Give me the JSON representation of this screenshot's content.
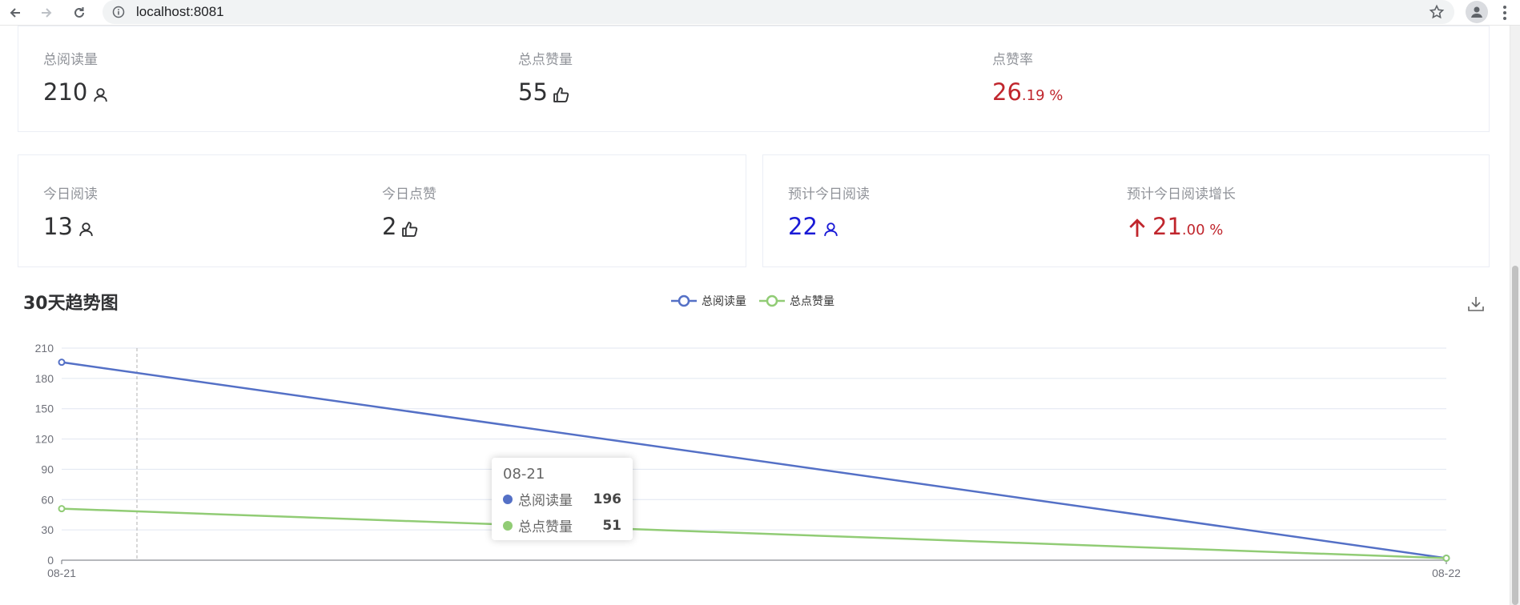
{
  "browser": {
    "url": "localhost:8081"
  },
  "totals": {
    "reads_label": "总阅读量",
    "reads_value": "210",
    "likes_label": "总点赞量",
    "likes_value": "55",
    "rate_label": "点赞率",
    "rate_int": "26",
    "rate_frac": ".19 %"
  },
  "today": {
    "reads_label": "今日阅读",
    "reads_value": "13",
    "likes_label": "今日点赞",
    "likes_value": "2"
  },
  "forecast": {
    "reads_label": "预计今日阅读",
    "reads_value": "22",
    "growth_label": "预计今日阅读增长",
    "growth_int": "21",
    "growth_frac": ".00 %"
  },
  "colors": {
    "accent_red": "#c0262d",
    "accent_blue": "#1a1ad6",
    "series_reads": "#5470c6",
    "series_likes": "#91cc75"
  },
  "icons": {
    "reads": "user-icon",
    "likes": "thumbs-up-icon",
    "growth": "arrow-up-icon",
    "download": "download-icon"
  },
  "chart_data": {
    "type": "line",
    "title": "30天趋势图",
    "categories": [
      "08-21",
      "08-22"
    ],
    "series": [
      {
        "name": "总阅读量",
        "values": [
          196,
          2
        ]
      },
      {
        "name": "总点赞量",
        "values": [
          51,
          2
        ]
      }
    ],
    "ylim": [
      0,
      210
    ],
    "yticks": [
      0,
      30,
      60,
      90,
      120,
      150,
      180,
      210
    ],
    "grid": true,
    "legend": "top-center",
    "tooltip": {
      "title": "08-21",
      "rows": [
        {
          "name": "总阅读量",
          "value": "196"
        },
        {
          "name": "总点赞量",
          "value": "51"
        }
      ]
    }
  }
}
